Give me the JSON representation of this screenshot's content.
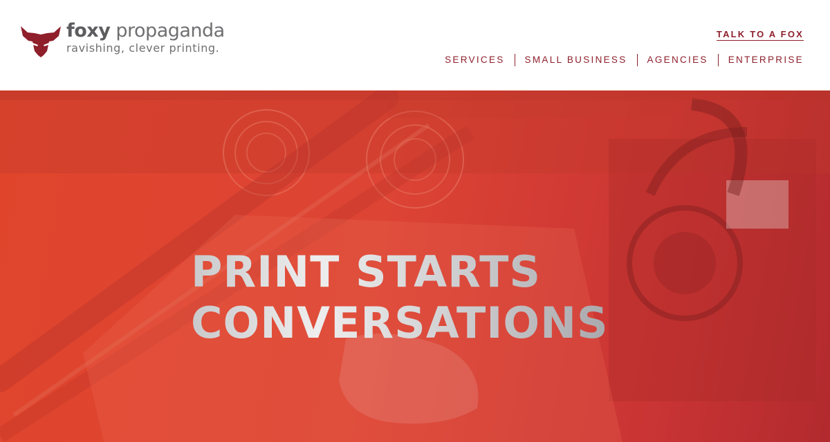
{
  "brand": {
    "name_bold": "foxy",
    "name_rest": " propaganda",
    "tagline": "ravishing, clever printing."
  },
  "header": {
    "cta_label": "TALK TO A FOX",
    "nav": [
      {
        "label": "SERVICES"
      },
      {
        "label": "SMALL BUSINESS"
      },
      {
        "label": "AGENCIES"
      },
      {
        "label": "ENTERPRISE"
      }
    ]
  },
  "hero": {
    "headline_line1": "PRINT STARTS",
    "headline_line2": "CONVERSATIONS"
  },
  "colors": {
    "brand_red": "#8e1f2b",
    "hero_red": "#dd4434",
    "logo_gray": "#6f6f72"
  },
  "icons": {
    "logo_mark": "fox-head-icon"
  }
}
